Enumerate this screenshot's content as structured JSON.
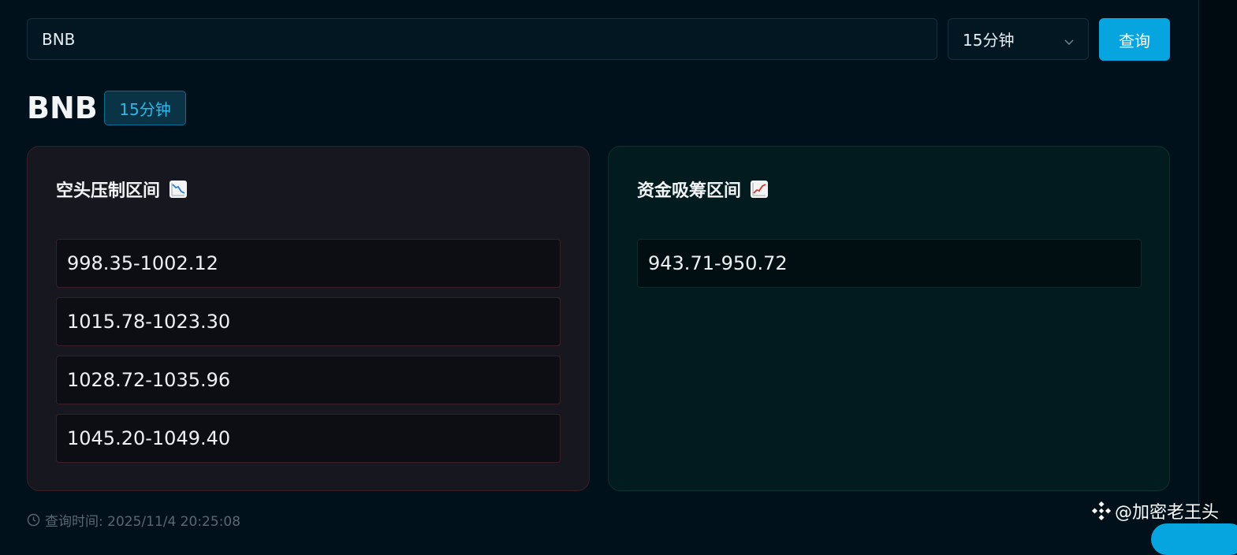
{
  "search": {
    "value": "BNB",
    "placeholder": ""
  },
  "interval_select": {
    "selected": "15分钟"
  },
  "query_button": {
    "label": "查询"
  },
  "result": {
    "symbol": "BNB",
    "interval_badge": "15分钟"
  },
  "bear_panel": {
    "title": "空头压制区间",
    "icon": "chart-decreasing-icon",
    "ranges": [
      "998.35-1002.12",
      "1015.78-1023.30",
      "1028.72-1035.96",
      "1045.20-1049.40"
    ]
  },
  "bull_panel": {
    "title": "资金吸筹区间",
    "icon": "chart-increasing-icon",
    "ranges": [
      "943.71-950.72"
    ]
  },
  "footer": {
    "query_time": "查询时间: 2025/11/4 20:25:08",
    "watermark": "@加密老王头"
  },
  "colors": {
    "accent": "#06a5df",
    "background": "#00111c",
    "bear_panel_bg": "#17171f",
    "bull_panel_bg": "#011b1e"
  }
}
